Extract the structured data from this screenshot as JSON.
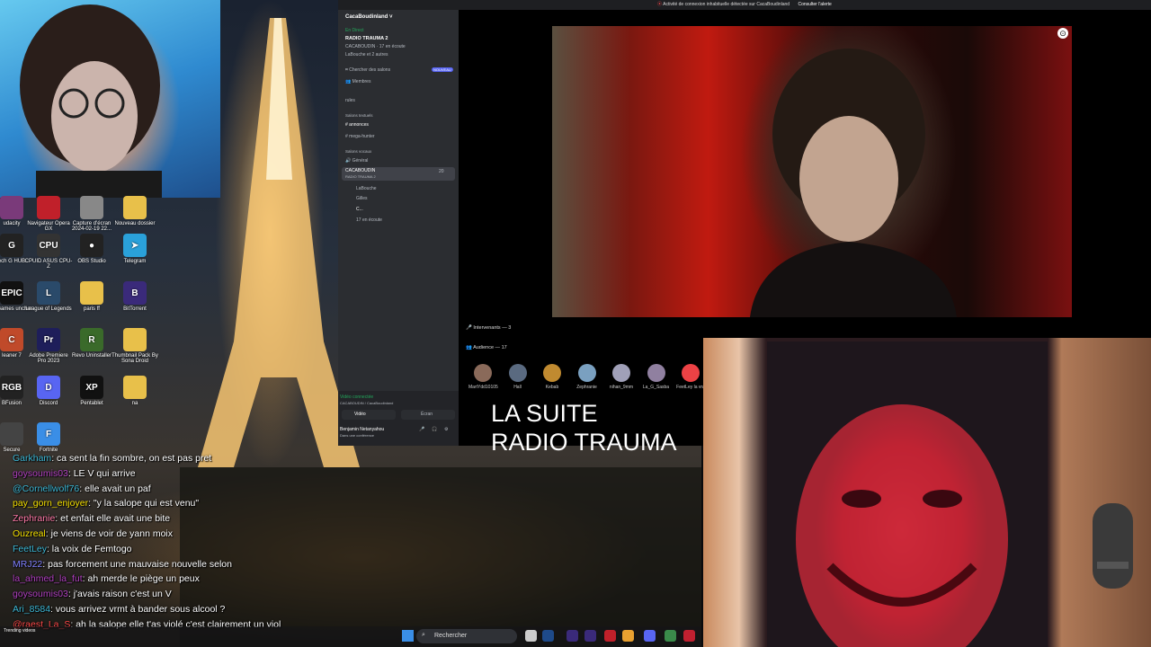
{
  "top_bar": {
    "alert_text": "Activité de connexion inhabituelle détectée sur CacaBoudinland",
    "alert_link": "Consulter l'alerte"
  },
  "discord": {
    "server_name": "CacaBoudinland",
    "live_badge": "En Direct",
    "stage_name": "RADIO TRAUMA 2",
    "stage_sub": "CACABOUDIN · 17 en écoute",
    "stage_speakers": "LaBouche et 2 autres",
    "browse_channels": "Chercher des salons",
    "new_badge": "NOUVEAU",
    "members": "Membres",
    "rules": "rules",
    "text_category": "Salons textuels",
    "text_channels": [
      "annonces",
      "mega-hunter"
    ],
    "voice_category": "Salons vocaux",
    "voice_channels": [
      "Général",
      "CACABOUDIN"
    ],
    "voice_sub": "RADIO TRAUMA 2",
    "voice_count": "20",
    "voice_users": [
      "LaBouche",
      "Gilles",
      "C..."
    ],
    "listeners": "17 en écoute",
    "video_connected": "Vidéo connectée",
    "video_connected_sub": "CACABOUDIN / CacaBoudinland",
    "video_btn": "Vidéo",
    "screen_btn": "Écran",
    "user_name": "Benjamin Netanyahou",
    "user_status": "Dans une conférence",
    "speakers_label": "Intervenants — 3",
    "audience_label": "Audience — 17",
    "audience": [
      {
        "name": "MartYdd10105",
        "color": "#8a6a5a"
      },
      {
        "name": "Hall",
        "color": "#5a6a80"
      },
      {
        "name": "Kebab",
        "color": "#c08a30"
      },
      {
        "name": "Zephranie",
        "color": "#7aa0c0"
      },
      {
        "name": "nihan_9mm",
        "color": "#a0a0b8"
      },
      {
        "name": "La_G_Sasba",
        "color": "#9080a0"
      },
      {
        "name": "FeetLey la vra",
        "color": "#ed4245"
      }
    ]
  },
  "overlay_title": [
    "LA SUITE",
    "RADIO TRAUMA"
  ],
  "desktop_icons": [
    {
      "label": "udacity",
      "abbr": ""
    },
    {
      "label": "Navigateur Opera GX",
      "abbr": ""
    },
    {
      "label": "Capture d'écran 2024-02-19 22...",
      "abbr": ""
    },
    {
      "label": "Nouveau dossier",
      "abbr": ""
    },
    {
      "label": "ech G HUB",
      "abbr": "G"
    },
    {
      "label": "CPUID ASUS CPU-Z",
      "abbr": "CPU"
    },
    {
      "label": "OBS Studio",
      "abbr": "●"
    },
    {
      "label": "Telegram",
      "abbr": "➤"
    },
    {
      "label": "ic Games uncher",
      "abbr": "EPIC"
    },
    {
      "label": "League of Legends",
      "abbr": "L"
    },
    {
      "label": "paris ff",
      "abbr": ""
    },
    {
      "label": "BitTorrent",
      "abbr": "B"
    },
    {
      "label": "leaner 7",
      "abbr": "C"
    },
    {
      "label": "Adobe Premiere Pro 2023",
      "abbr": "Pr"
    },
    {
      "label": "Revo Uninstaller",
      "abbr": "R"
    },
    {
      "label": "Thumbnail Pack By Sona Droid",
      "abbr": ""
    },
    {
      "label": "BFusion",
      "abbr": "RGB"
    },
    {
      "label": "Discord",
      "abbr": "D"
    },
    {
      "label": "Pentablet",
      "abbr": "XP"
    },
    {
      "label": "na",
      "abbr": ""
    },
    {
      "label": "Secure",
      "abbr": ""
    },
    {
      "label": "Fortnite",
      "abbr": "F"
    }
  ],
  "chat": [
    {
      "user": "Garkham",
      "user_color": "#3db8d6",
      "text": "ca sent la fin sombre, on est pas pret"
    },
    {
      "user": "goysoumis03",
      "user_color": "#b040c0",
      "text": "LE V qui arrive"
    },
    {
      "user": "@Cornellwolf76",
      "user_color": "#3db8d6",
      "text": "elle avait un paf"
    },
    {
      "user": "pay_gorn_enjoyer",
      "user_color": "#f5e000",
      "text": "\"y la salope qui est venu\""
    },
    {
      "user": "Zephranie",
      "user_color": "#ff7aa8",
      "text": "et enfait elle avait une bite"
    },
    {
      "user": "Ouzreal",
      "user_color": "#f5e000",
      "text": "je viens de voir de yann moix"
    },
    {
      "user": "FeetLey",
      "user_color": "#3db8d6",
      "text": "la voix de Femtogo"
    },
    {
      "user": "MRJ22",
      "user_color": "#8080ff",
      "text": "pas forcement une mauvaise nouvelle selon"
    },
    {
      "user": "la_ahmed_la_fut",
      "user_color": "#b040c0",
      "text": "ah merde le piège un peux"
    },
    {
      "user": "goysoumis03",
      "user_color": "#b040c0",
      "text": "j'avais raison c'est un V"
    },
    {
      "user": "Ari_8584",
      "user_color": "#3db8d6",
      "text": "vous arrivez vrmt à bander sous alcool ?"
    },
    {
      "user": "@raest_La_S",
      "user_color": "#ff4a4a",
      "text": "ah la salope elle t'as violé c'est clairement un viol"
    }
  ],
  "taskbar": {
    "search_label": "Rechercher",
    "trending": "Trending videos"
  }
}
